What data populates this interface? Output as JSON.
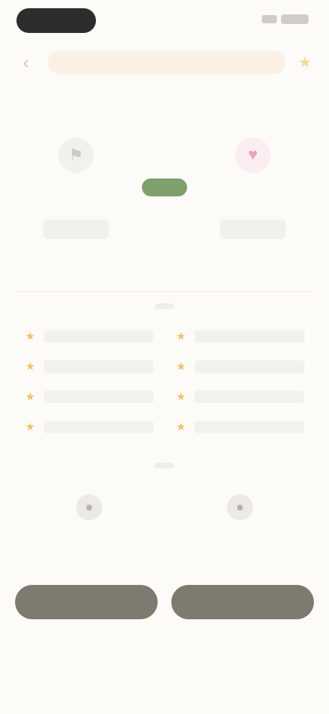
{
  "status_bar": {
    "pill_text": ""
  },
  "banner": {
    "back_icon": "chevron-left",
    "text": "",
    "star_icon": "star"
  },
  "matchup": {
    "home_team": {
      "name": "",
      "logo": "team-logo"
    },
    "away_team": {
      "name": "",
      "logo": "team-logo"
    },
    "score": ""
  },
  "stats_section": {
    "title": "",
    "left": [
      {
        "icon": "star",
        "text": ""
      },
      {
        "icon": "star",
        "text": ""
      },
      {
        "icon": "star",
        "text": ""
      },
      {
        "icon": "star",
        "text": ""
      }
    ],
    "right": [
      {
        "icon": "star",
        "text": ""
      },
      {
        "icon": "star",
        "text": ""
      },
      {
        "icon": "star",
        "text": ""
      },
      {
        "icon": "star",
        "text": ""
      }
    ]
  },
  "players_section": {
    "title": "",
    "left_player": {
      "name": "",
      "sub": ""
    },
    "right_player": {
      "name": "",
      "sub": ""
    }
  },
  "actions": {
    "left_label": "",
    "right_label": ""
  },
  "colors": {
    "background": "#fdfbf8",
    "score_green": "#7fa06a",
    "button": "#7e7a6f",
    "accent_star": "#f0c16a",
    "away_accent": "#e7a6b8"
  }
}
